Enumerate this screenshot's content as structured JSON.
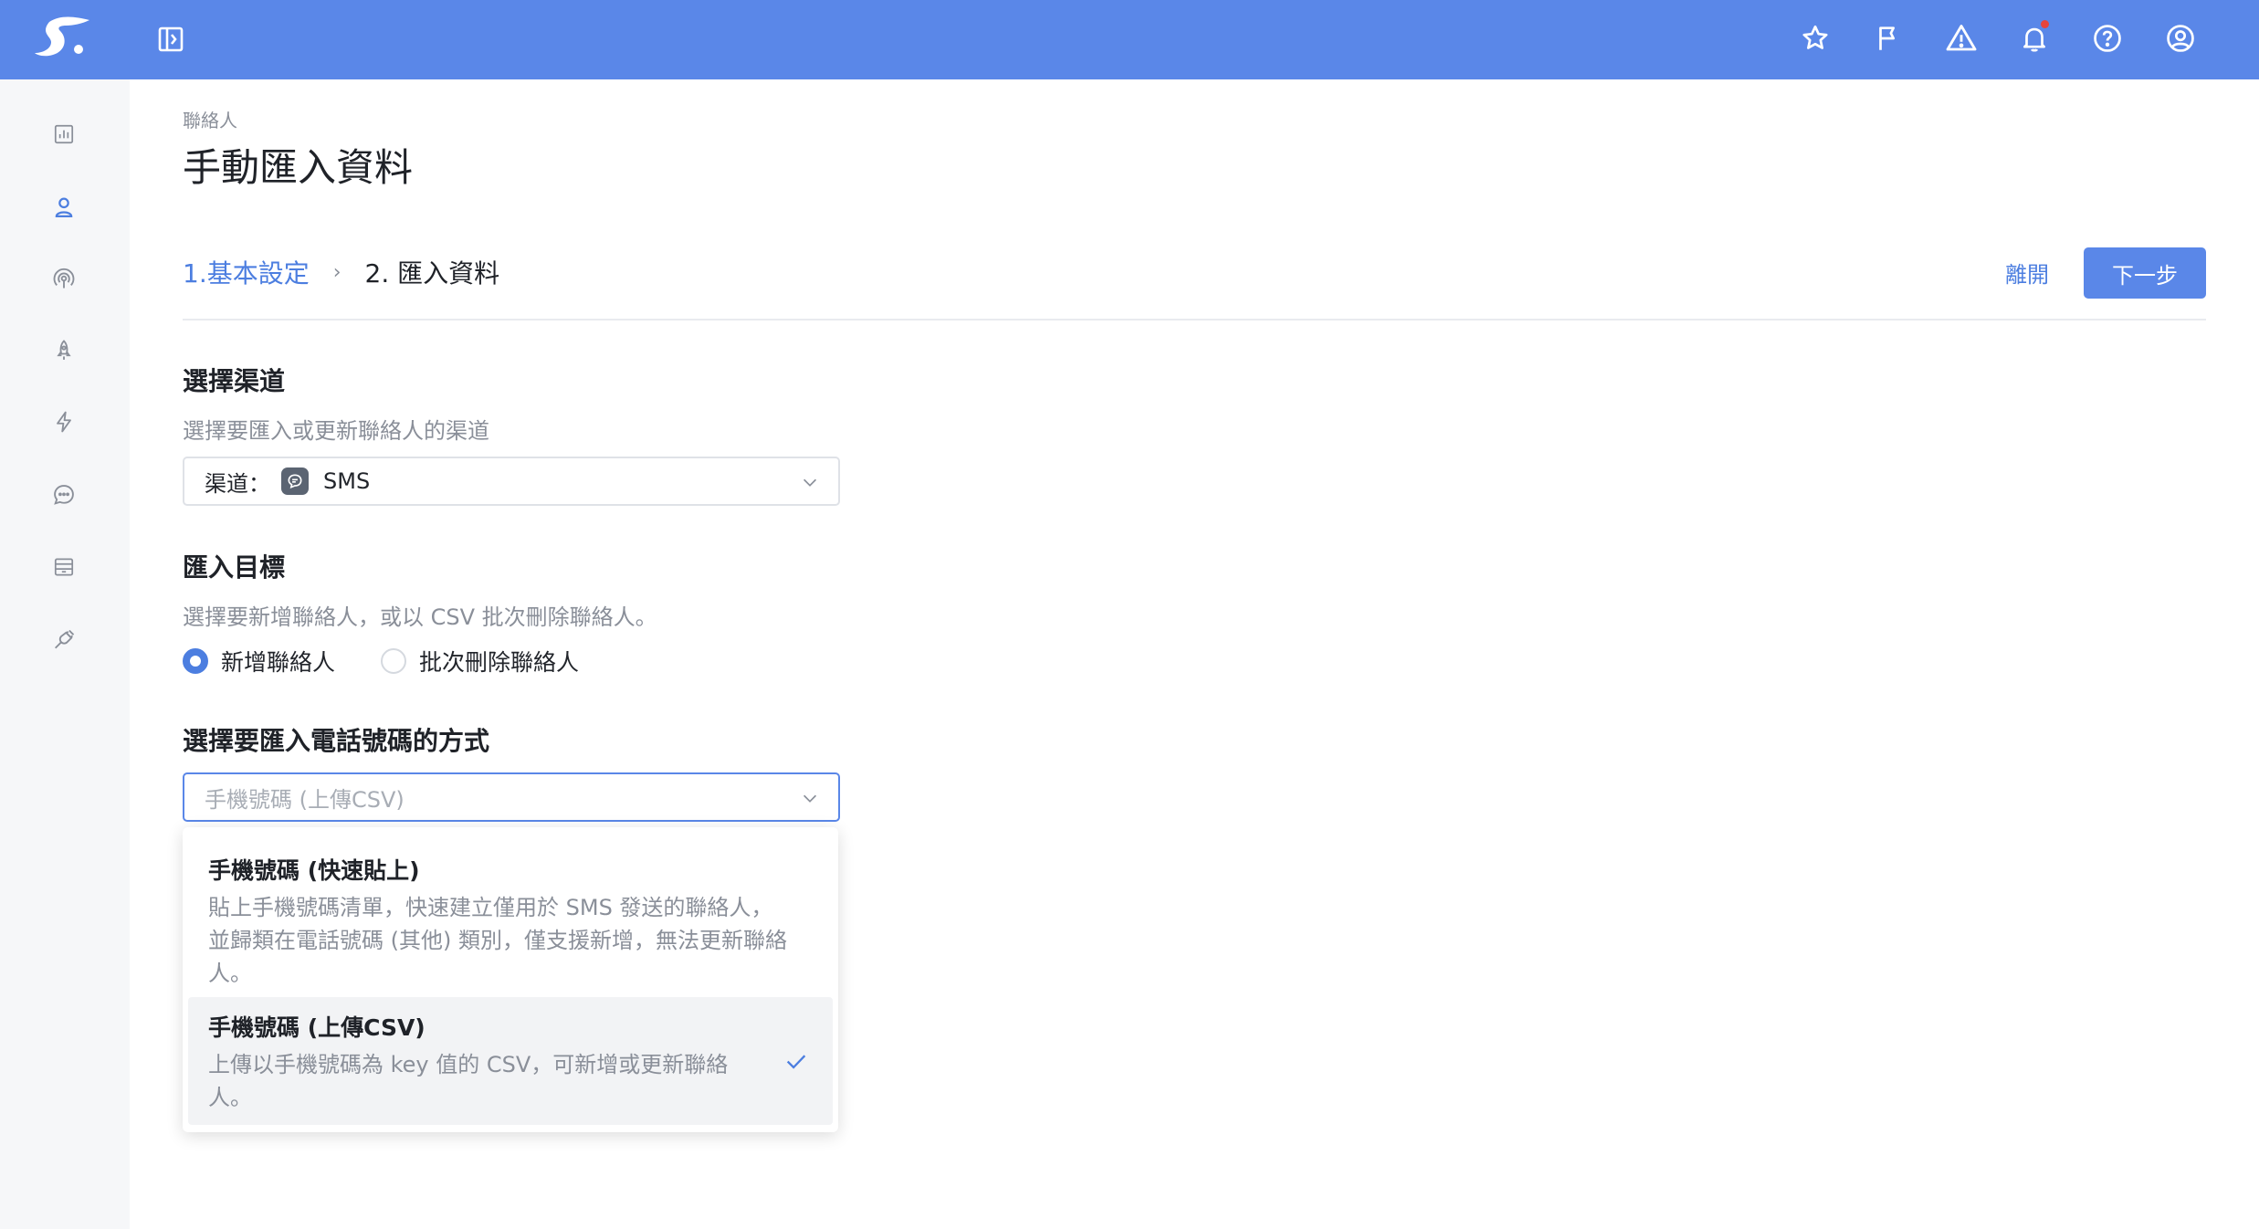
{
  "breadcrumb": "聯絡人",
  "page_title": "手動匯入資料",
  "steps": {
    "step1": "1.基本設定",
    "separator": "›",
    "step2": "2. 匯入資料"
  },
  "actions": {
    "leave": "離開",
    "next": "下一步"
  },
  "channel_section": {
    "title": "選擇渠道",
    "description": "選擇要匯入或更新聯絡人的渠道",
    "select_label": "渠道：",
    "select_value": "SMS"
  },
  "target_section": {
    "title": "匯入目標",
    "description": "選擇要新增聯絡人，或以 CSV 批次刪除聯絡人。",
    "options": [
      {
        "label": "新增聯絡人",
        "checked": true
      },
      {
        "label": "批次刪除聯絡人",
        "checked": false
      }
    ]
  },
  "method_section": {
    "title": "選擇要匯入電話號碼的方式",
    "placeholder": "手機號碼 (上傳CSV)",
    "options": [
      {
        "title": "手機號碼 (快速貼上)",
        "desc_lines": [
          "貼上手機號碼清單，快速建立僅用於 SMS 發送的聯絡人，",
          "並歸類在電話號碼 (其他) 類別，僅支援新增，無法更新聯絡",
          "人。"
        ],
        "selected": false
      },
      {
        "title": "手機號碼 (上傳CSV)",
        "desc_lines": [
          "上傳以手機號碼為 key 值的 CSV，可新增或更新聯絡",
          "人。"
        ],
        "selected": true
      }
    ]
  },
  "colors": {
    "topbar": "#5a87e8",
    "accent": "#4c7ee0",
    "muted_text": "#8a8f99",
    "notification_dot": "#e8453c"
  },
  "icons": {
    "logo": "brand-logo",
    "sidebar_toggle": "sidebar-toggle-icon",
    "top": [
      "star-icon",
      "flag-icon",
      "warning-icon",
      "bell-icon",
      "help-icon",
      "user-circle-icon"
    ],
    "side": [
      "chart-icon",
      "contacts-icon",
      "broadcast-icon",
      "rocket-icon",
      "bolt-icon",
      "chat-icon",
      "inbox-icon",
      "plug-icon"
    ]
  }
}
